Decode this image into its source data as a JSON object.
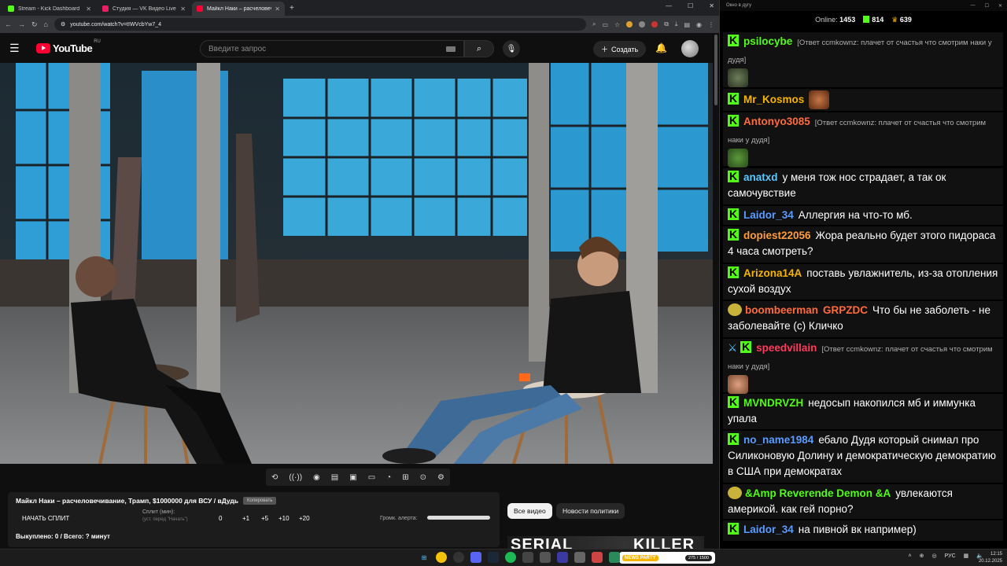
{
  "browser": {
    "tabs": [
      {
        "title": "Stream - Kick Dashboard",
        "color": "#53fc18"
      },
      {
        "title": "Студия — VK Видео Live",
        "color": "#e91e63"
      },
      {
        "title": "Майкл Наки – расчеловечи",
        "color": "#ff0033"
      }
    ],
    "url": "youtube.com/watch?v=tIWVcbYw7_4"
  },
  "youtube": {
    "logo": "YouTube",
    "region": "RU",
    "search_placeholder": "Введите запрос",
    "create_label": "Создать"
  },
  "panel": {
    "title": "Майкл Наки – расчеловечивание, Трамп, $1000000 для ВСУ / вДудь",
    "copy_label": "Копировать",
    "start_split": "НАЧАТЬ СПЛИТ",
    "split_label": "Сплит (мин):",
    "split_hint": "(уст. перед \"Начать\")",
    "split_value": "0",
    "buttons": [
      "+1",
      "+5",
      "+10",
      "+20"
    ],
    "alert_volume_label": "Громк. алерта:",
    "bought": "Выкуплено: 0 / Всего: ? минут"
  },
  "chips": {
    "all": "Все видео",
    "politics": "Новости политики"
  },
  "thumb_text": {
    "a": "SERIAL",
    "b": "KILLER"
  },
  "chat": {
    "window_title": "Окно в дугу",
    "online_label": "Online:",
    "online": "1453",
    "followers": "814",
    "subs": "639",
    "messages": [
      {
        "name": "psilocybe",
        "color": "#53fc18",
        "reply": "[Ответ ccmkownz: плачет от счастья что смотрим наки у дудя]",
        "text": ""
      },
      {
        "name": "Mr_Kosmos",
        "color": "#f7b500",
        "reply": "",
        "text": ""
      },
      {
        "name": "Antonyo3085",
        "color": "#ff6b3d",
        "reply": "[Ответ ccmkownz: плачет от счастья что смотрим наки у дудя]",
        "text": ""
      },
      {
        "name": "anatxd",
        "color": "#5bc8ff",
        "reply": "",
        "text": "у меня тож нос страдает, а так ок самочувствие"
      },
      {
        "name": "Laidor_34",
        "color": "#5b9bff",
        "reply": "",
        "text": "Аллергия на что-то мб."
      },
      {
        "name": "dopiest22056",
        "color": "#ff9d3d",
        "reply": "",
        "text": "Жора реально будет этого пидораса 4 часа смотреть?"
      },
      {
        "name": "Arizona14A",
        "color": "#f7b500",
        "reply": "",
        "text": "поставь увлажнитель, из-за отопления сухой воздух"
      },
      {
        "name": "boombeerman",
        "color": "#ff6b3d",
        "badge2": "GRPZDC",
        "reply": "",
        "text": "Что бы не заболеть - не заболевайте (с) Кличко"
      },
      {
        "name": "speedvillain",
        "color": "#ff3b5c",
        "reply": "[Ответ ccmkownz: плачет от счастья что смотрим наки у дудя]",
        "text": ""
      },
      {
        "name": "MVNDRVZH",
        "color": "#53fc18",
        "reply": "",
        "text": "недосып накопился мб и иммунка упала"
      },
      {
        "name": "no_name1984",
        "color": "#5b9bff",
        "reply": "",
        "text": "ебало Дудя который снимал про Силиконовую Долину и демократическую демократию в США при демократах"
      },
      {
        "name": "&Amp Reverende Demon &A",
        "color": "#53fc18",
        "reply": "",
        "text": "увлекаются америкой. как гей порно?"
      },
      {
        "name": "Laidor_34",
        "color": "#5b9bff",
        "reply": "",
        "text": "на пивной вк например)"
      }
    ]
  },
  "taskbar": {
    "lang": "РУС",
    "time": "12:15",
    "date": "20.12.2025",
    "kick_badge": "NEWS PARTY",
    "kick_count": "275 / 1500"
  }
}
